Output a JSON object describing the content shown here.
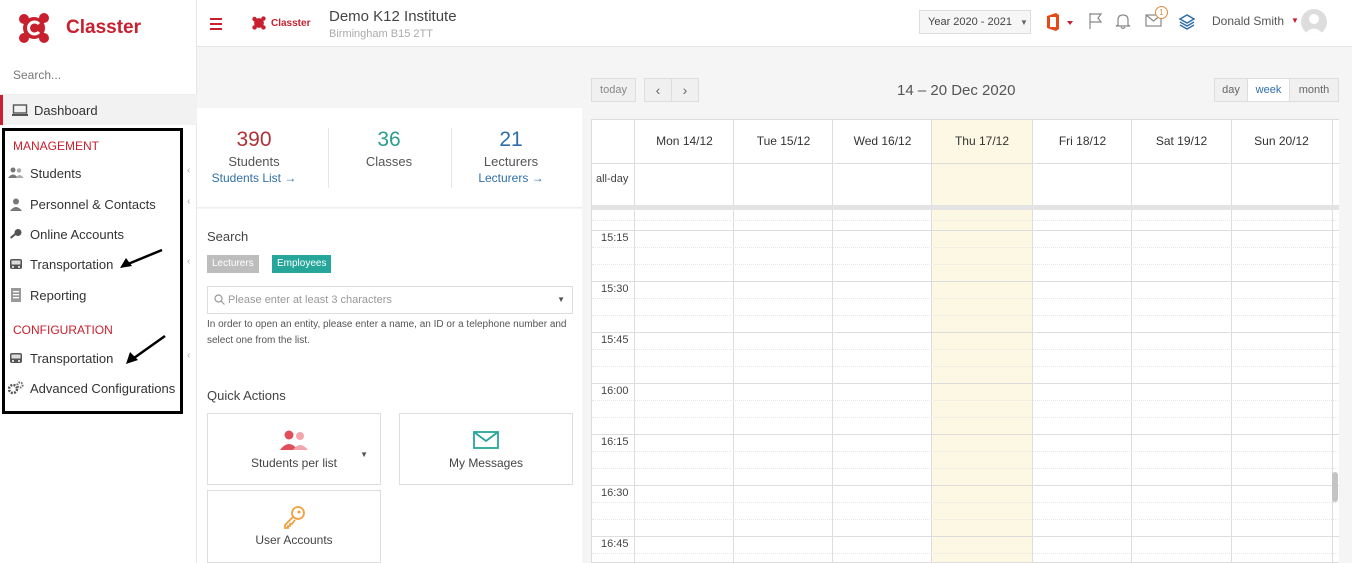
{
  "sidebar": {
    "logo_text": "Classter",
    "search_placeholder": "Search...",
    "dashboard": "Dashboard",
    "management_header": "MANAGEMENT",
    "management_items": [
      "Students",
      "Personnel & Contacts",
      "Online Accounts",
      "Transportation",
      "Reporting"
    ],
    "configuration_header": "CONFIGURATION",
    "configuration_items": [
      "Transportation",
      "Advanced Configurations"
    ]
  },
  "header": {
    "small_logo": "Classter",
    "institute_name": "Demo K12 Institute",
    "institute_address": "Birmingham B15 2TT",
    "year": "Year 2020 - 2021",
    "notifications_count": "1",
    "user_name": "Donald Smith"
  },
  "stats": [
    {
      "number": "390",
      "label": "Students",
      "link": "Students List",
      "color": "#b0303a"
    },
    {
      "number": "36",
      "label": "Classes",
      "link": "",
      "color": "#2a9d8f"
    },
    {
      "number": "21",
      "label": "Lecturers",
      "link": "Lecturers",
      "color": "#2f6fa8"
    }
  ],
  "search": {
    "title": "Search",
    "tag_lecturers": "Lecturers",
    "tag_employees": "Employees",
    "placeholder": "Please enter at least 3 characters",
    "hint": "In order to open an entity, please enter a name, an ID or a telephone number and select one from the list."
  },
  "quick_actions": {
    "title": "Quick Actions",
    "students_per_list": "Students per list",
    "my_messages": "My Messages",
    "user_accounts": "User Accounts"
  },
  "calendar": {
    "today": "today",
    "prev": "‹",
    "next": "›",
    "range": "14 – 20 Dec 2020",
    "views": [
      "day",
      "week",
      "month"
    ],
    "active_view": "week",
    "days": [
      "Mon 14/12",
      "Tue 15/12",
      "Wed 16/12",
      "Thu 17/12",
      "Fri 18/12",
      "Sat 19/12",
      "Sun 20/12"
    ],
    "today_index": 3,
    "all_day": "all-day",
    "times": [
      "15:15",
      "15:30",
      "15:45",
      "16:00",
      "16:15",
      "16:30",
      "16:45"
    ]
  },
  "colors": {
    "brand": "#c8202f",
    "link": "#2f6fa8",
    "teal": "#2a9d8f",
    "today_bg": "#fcf8e3"
  }
}
